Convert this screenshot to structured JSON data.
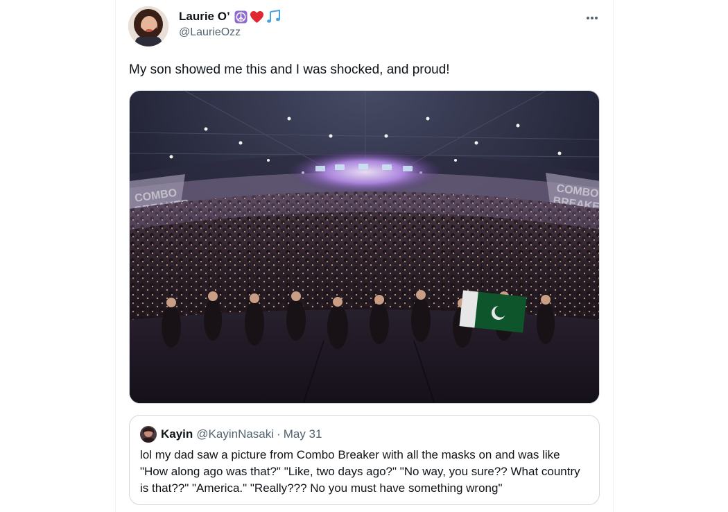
{
  "tweet": {
    "display_name": "Laurie O’",
    "handle": "@LaurieOzz",
    "emojis": [
      "peace-symbol-icon",
      "red-heart-icon",
      "musical-notes-icon"
    ],
    "text": "My son showed me this and I was shocked, and proud!",
    "more_icon": "more-horizontal-icon",
    "media": {
      "description_icon": "crowd-photo",
      "banner_text": "COMBO BREAKER"
    }
  },
  "quote": {
    "display_name": "Kayin",
    "handle": "@KayinNasaki",
    "separator": "·",
    "date": "May 31",
    "text": "lol my dad saw a picture from Combo Breaker with all the masks on and was like \"How along ago was that?\" \"Like, two days ago?\" \"No way, you sure?? What country is that??\" \"America.\" \"Really??? No you must have something wrong\""
  },
  "colors": {
    "text_primary": "#0f1419",
    "text_secondary": "#536471",
    "border": "#cfd9de",
    "emoji_peace_bg": "#8e6ccd",
    "emoji_heart": "#e0262f",
    "emoji_notes": "#4aa3df"
  }
}
